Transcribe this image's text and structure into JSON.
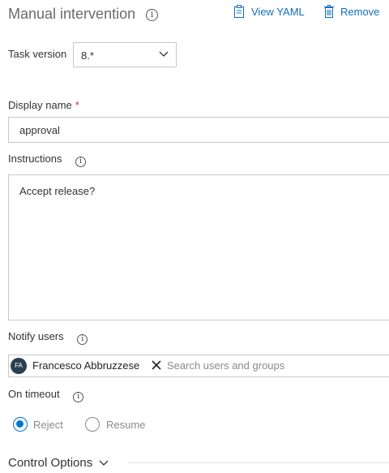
{
  "header": {
    "title": "Manual intervention",
    "view_yaml_label": "View YAML",
    "remove_label": "Remove"
  },
  "task_version": {
    "label": "Task version",
    "value": "8.*"
  },
  "display_name": {
    "label": "Display name",
    "required_mark": "*",
    "value": "approval"
  },
  "instructions": {
    "label": "Instructions",
    "value": "Accept release?"
  },
  "notify_users": {
    "label": "Notify users",
    "chips": [
      {
        "initials": "FA",
        "name": "Francesco Abbruzzese"
      }
    ],
    "placeholder": "Search users and groups"
  },
  "on_timeout": {
    "label": "On timeout",
    "options": [
      {
        "label": "Reject",
        "selected": true
      },
      {
        "label": "Resume",
        "selected": false
      }
    ]
  },
  "control_options": {
    "label": "Control Options"
  },
  "colors": {
    "accent": "#0078d4",
    "link": "#106ebe",
    "required": "#c4314b",
    "avatar_bg": "#29404e"
  }
}
